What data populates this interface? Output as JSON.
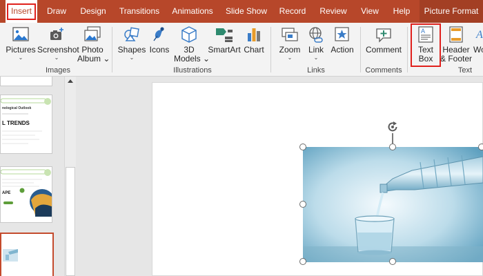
{
  "ribbon_tabs": [
    {
      "label": "Insert",
      "active": true
    },
    {
      "label": "Draw"
    },
    {
      "label": "Design"
    },
    {
      "label": "Transitions"
    },
    {
      "label": "Animations"
    },
    {
      "label": "Slide Show"
    },
    {
      "label": "Record"
    },
    {
      "label": "Review"
    },
    {
      "label": "View"
    },
    {
      "label": "Help"
    },
    {
      "label": "Picture Format",
      "contextual": true
    }
  ],
  "groups": {
    "images": {
      "label": "Images",
      "pictures": "Pictures",
      "screenshot": "Screenshot",
      "photo_album_line1": "Photo",
      "photo_album_line2": "Album"
    },
    "illustrations": {
      "label": "Illustrations",
      "shapes": "Shapes",
      "icons": "Icons",
      "models_line1": "3D",
      "models_line2": "Models",
      "smartart": "SmartArt",
      "chart": "Chart"
    },
    "links": {
      "label": "Links",
      "zoom": "Zoom",
      "link": "Link",
      "action": "Action"
    },
    "comments": {
      "label": "Comments",
      "comment": "Comment"
    },
    "text": {
      "label": "Text",
      "textbox_line1": "Text",
      "textbox_line2": "Box",
      "header_line1": "Header",
      "header_line2": "& Footer",
      "wordart_partial": "Wo"
    }
  },
  "thumbnails": {
    "slide_a_heading": "nological Outlook",
    "slide_a_title": "L TRENDS",
    "slide_b_title": "APE"
  },
  "colors": {
    "accent": "#b7472a",
    "highlight_box": "#e0201c",
    "thumb_green": "#5e9e3a"
  },
  "icons": [
    "pictures-icon",
    "screenshot-icon",
    "photo-album-icon",
    "shapes-icon",
    "icons-icon",
    "3d-models-icon",
    "smartart-icon",
    "chart-icon",
    "zoom-icon",
    "link-icon",
    "action-icon",
    "comment-icon",
    "text-box-icon",
    "header-footer-icon",
    "rotate-handle-icon"
  ]
}
